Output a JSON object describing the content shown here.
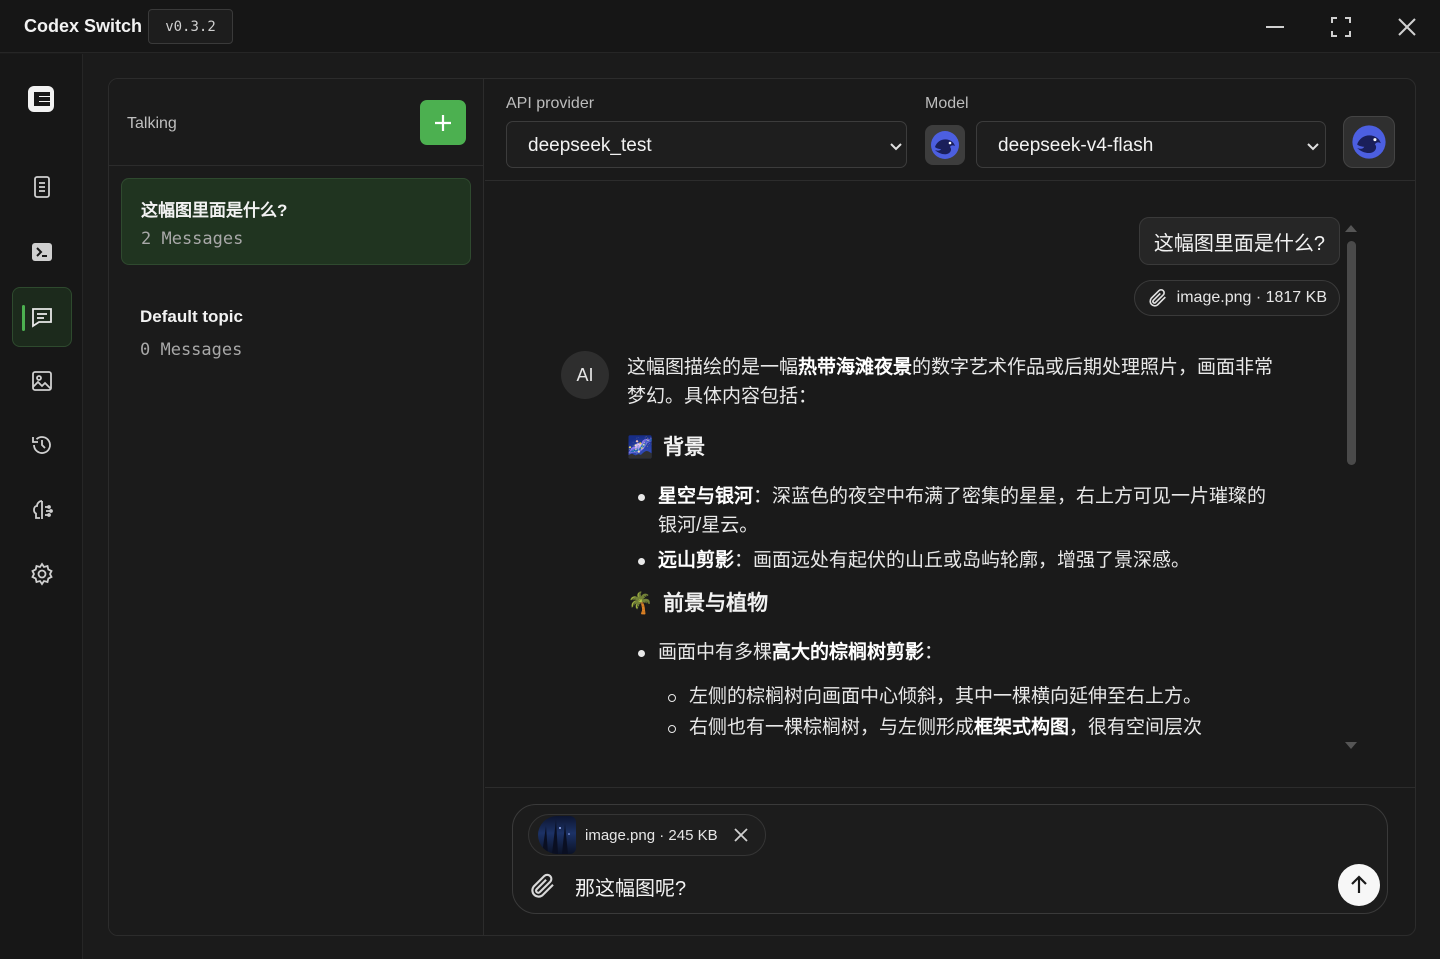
{
  "window": {
    "title": "Codex Switch",
    "version": "v0.3.2",
    "controls": [
      "minimize-icon",
      "maximize-icon",
      "close-icon"
    ]
  },
  "nav": {
    "logo": "app-logo-icon",
    "items": [
      {
        "id": "documents",
        "icon": "document-icon",
        "active": false
      },
      {
        "id": "terminal",
        "icon": "terminal-icon",
        "active": false
      },
      {
        "id": "chat",
        "icon": "chat-icon",
        "active": true
      },
      {
        "id": "images",
        "icon": "image-icon",
        "active": false
      },
      {
        "id": "history",
        "icon": "history-icon",
        "active": false
      },
      {
        "id": "skills",
        "icon": "brain-icon",
        "active": false
      },
      {
        "id": "settings",
        "icon": "gear-icon",
        "active": false
      }
    ],
    "accent": "#4cb050"
  },
  "topics": {
    "header": "Talking",
    "items": [
      {
        "title": "这幅图里面是什么?",
        "count": "2 Messages",
        "selected": true
      },
      {
        "title": "Default topic",
        "count": "0 Messages",
        "selected": false
      }
    ]
  },
  "chat": {
    "provider_label": "API provider",
    "provider_value": "deepseek_test",
    "model_label": "Model",
    "model_value": "deepseek-v4-flash",
    "user_message": "这幅图里面是什么?",
    "user_attachment": "image.png · 1817 KB",
    "ai_avatar": "AI",
    "ai_intro_1": "这幅图描绘的是一幅",
    "ai_intro_bold": "热带海滩夜景",
    "ai_intro_2": "的数字艺术作品或后期处理照片，画面非常梦幻。具体内容包括：",
    "section1_emoji": "🌌",
    "section1_title": "背景",
    "s1_item1_bold": "星空与银河",
    "s1_item1_text": "：深蓝色的夜空中布满了密集的星星，右上方可见一片璀璨的银河/星云。",
    "s1_item2_bold": "远山剪影",
    "s1_item2_text": "：画面远处有起伏的山丘或岛屿轮廓，增强了景深感。",
    "section2_emoji": "🌴",
    "section2_title": "前景与植物",
    "s2_item1_text": "画面中有多棵",
    "s2_item1_bold": "高大的棕榈树剪影",
    "s2_item1_end": "：",
    "s2_sub1": "左侧的棕榈树向画面中心倾斜，其中一棵横向延伸至右上方。",
    "s2_sub2_a": "右侧也有一棵棕榈树，与左侧形成",
    "s2_sub2_bold": "框架式构图",
    "s2_sub2_b": "，很有空间层次"
  },
  "composer": {
    "file_name": "image.png · 245 KB",
    "input_value": "那这幅图呢?",
    "send_icon": "arrow-up-icon",
    "attach_icon": "paperclip-icon"
  }
}
